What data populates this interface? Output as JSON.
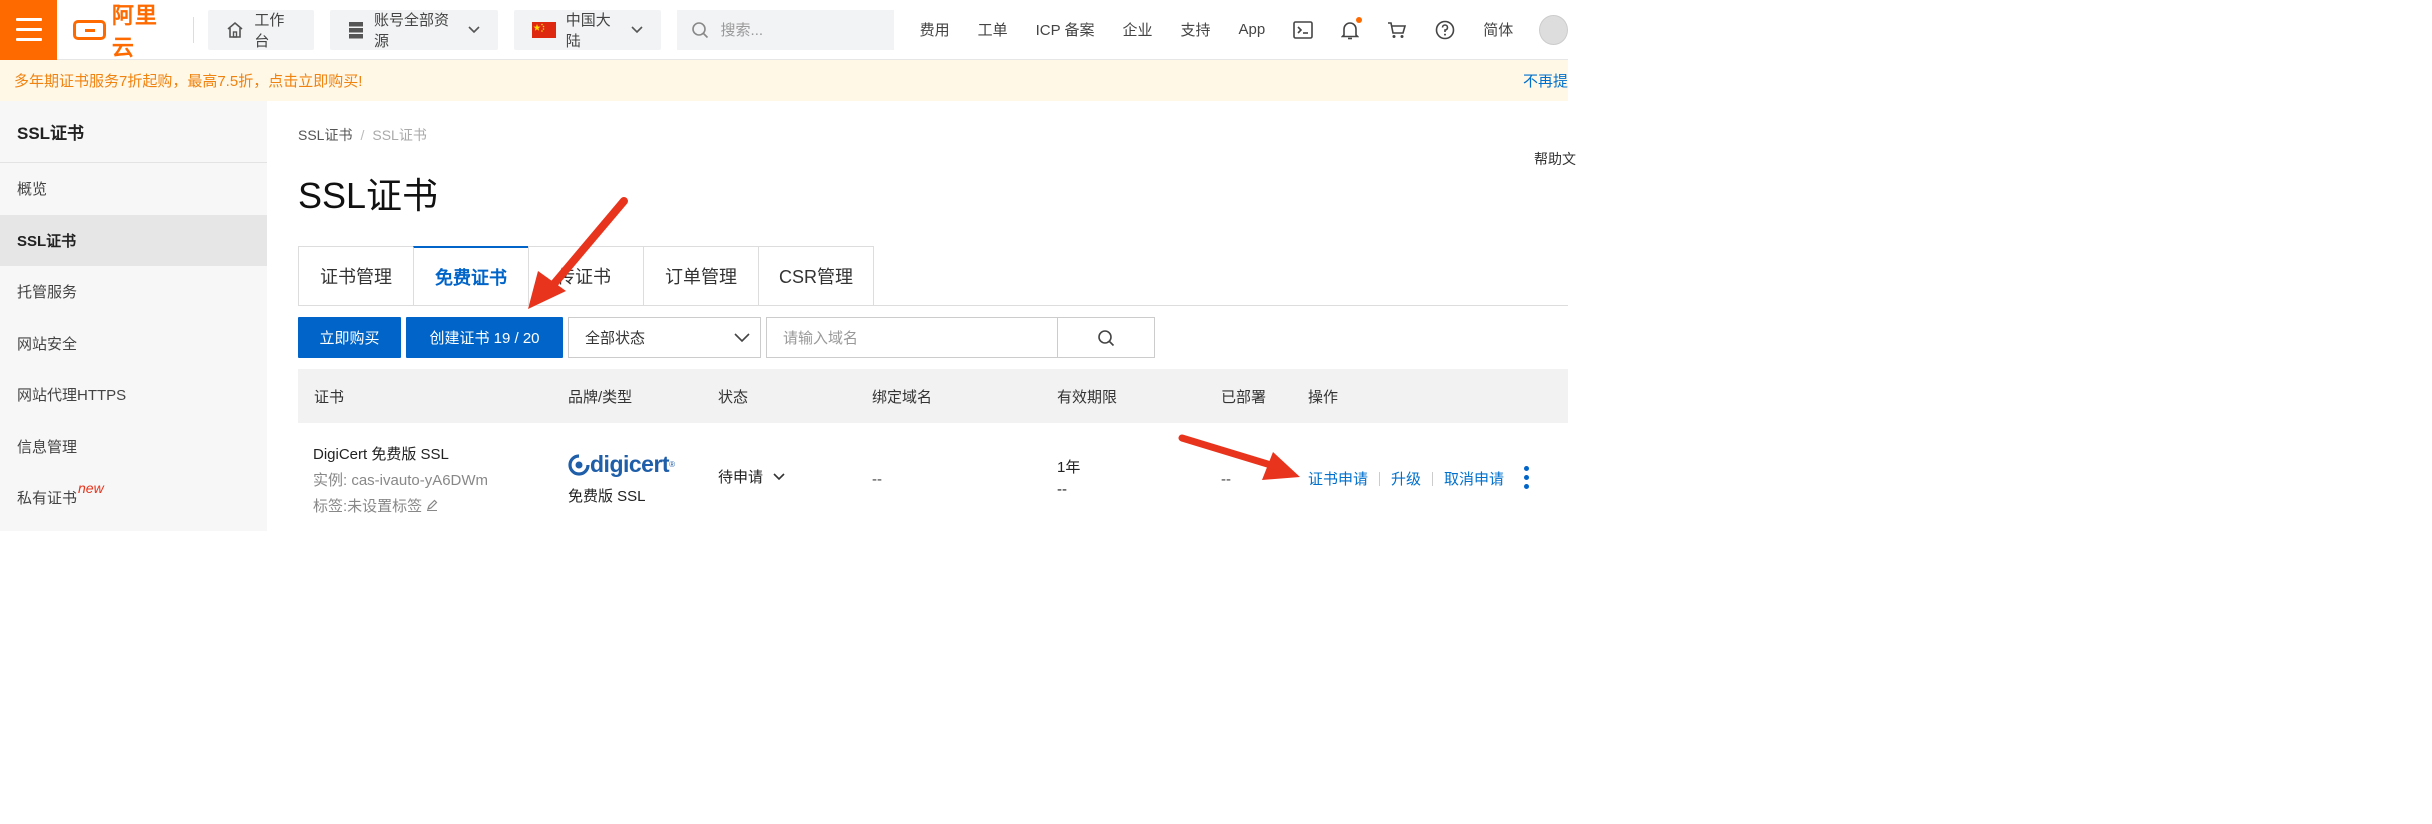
{
  "topbar": {
    "brand": "阿里云",
    "workbench": "工作台",
    "resources": "账号全部资源",
    "region": "中国大陆",
    "search_placeholder": "搜索...",
    "links": [
      "费用",
      "工单",
      "ICP 备案",
      "企业",
      "支持",
      "App"
    ],
    "lang": "简体",
    "accent_color": "#ff6a00"
  },
  "banner": {
    "promo": "多年期证书服务7折起购，最高7.5折，点击立即购买!",
    "dismiss": "不再提"
  },
  "sidebar": {
    "title": "SSL证书",
    "items": [
      {
        "label": "概览"
      },
      {
        "label": "SSL证书"
      },
      {
        "label": "托管服务"
      },
      {
        "label": "网站安全"
      },
      {
        "label": "网站代理HTTPS"
      },
      {
        "label": "信息管理"
      },
      {
        "label": "私有证书",
        "badge": "new"
      }
    ]
  },
  "page": {
    "breadcrumb": [
      "SSL证书",
      "SSL证书"
    ],
    "help": "帮助文",
    "title": "SSL证书",
    "tabs": [
      "证书管理",
      "免费证书",
      "上传证书",
      "订单管理",
      "CSR管理"
    ],
    "tab_visible_fragment": "传证书"
  },
  "toolbar": {
    "buy": "立即购买",
    "create": "创建证书 19 / 20",
    "status_select": "全部状态",
    "domain_placeholder": "请输入域名"
  },
  "table": {
    "columns": [
      "证书",
      "品牌/类型",
      "状态",
      "绑定域名",
      "有效期限",
      "已部署",
      "操作"
    ],
    "rows": [
      {
        "name": "DigiCert 免费版 SSL",
        "instance": "实例: cas-ivauto-yA6DWm",
        "tag": "标签:未设置标签",
        "brand_logo": "digicert",
        "brand_type": "免费版 SSL",
        "status": "待申请",
        "domain": "--",
        "validity": "1年",
        "validity_sub": "--",
        "deployed": "--",
        "actions": [
          "证书申请",
          "升级",
          "取消申请"
        ]
      }
    ]
  }
}
